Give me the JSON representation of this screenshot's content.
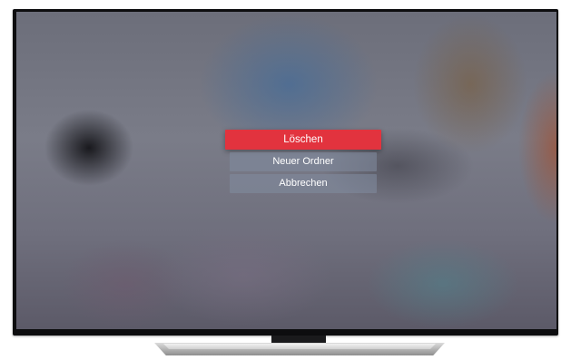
{
  "dialog": {
    "items": [
      {
        "label": "Löschen",
        "state": "focused"
      },
      {
        "label": "Neuer Ordner",
        "state": "normal"
      },
      {
        "label": "Abbrechen",
        "state": "normal"
      }
    ]
  },
  "colors": {
    "focus_accent": "#e2333e",
    "button_background": "#8c96aa",
    "text": "#ffffff"
  }
}
